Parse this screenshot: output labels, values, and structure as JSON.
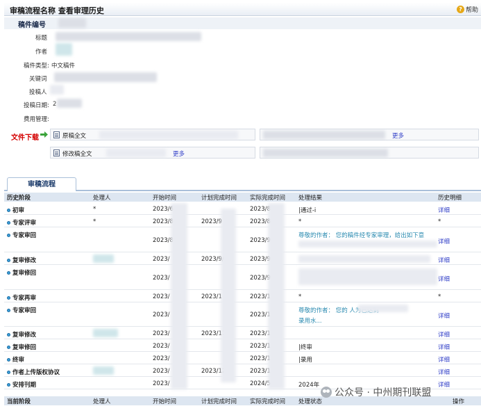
{
  "header": {
    "title": "审稿流程名称 查看审理历史",
    "help_label": "帮助"
  },
  "info": {
    "section_label": "稿件编号",
    "title_label": "标题",
    "author_label": "作者",
    "type_label": "稿件类型:",
    "type_value": "中文稿件",
    "keywords_label": "关键词",
    "submitter_label": "投稿人",
    "date_label": "投稿日期:",
    "date_value": "2",
    "fee_label": "费用管理:"
  },
  "downloads": {
    "label": "文件下载",
    "original_label": "原稿全文",
    "revised_label": "修改稿全文",
    "more_label": "更多"
  },
  "tab_label": "审稿流程",
  "history_columns": [
    "历史阶段",
    "处理人",
    "开始时间",
    "计划完成时间",
    "实际完成时间",
    "处理结果",
    "历史明细"
  ],
  "rows": [
    {
      "stage": "初审",
      "handler": "*",
      "start": "2023/6",
      "plan": "",
      "actual": "2023/8",
      "result": "|通过-i",
      "detail": "详细"
    },
    {
      "stage": "专家评审",
      "handler": "*",
      "start": "2023/8",
      "plan": "2023/9",
      "actual": "2023/8",
      "result": "*",
      "detail": "*"
    },
    {
      "stage": "专家审回",
      "handler": "",
      "start": "2023/8",
      "plan": "",
      "actual": "2023/9",
      "result": "尊敬的作者：  您的稿件经专家审理，给出如下意",
      "detail": "详细"
    },
    {
      "stage": "复审修改",
      "handler": "",
      "start": "2023/",
      "plan": "2023/9/",
      "actual": "2023/9",
      "result": "",
      "detail": "详细"
    },
    {
      "stage": "复审修回",
      "handler": "",
      "start": "2023/",
      "plan": "",
      "actual": "2023/9",
      "result": "",
      "detail": "详细"
    },
    {
      "stage": "专家再审",
      "handler": "",
      "start": "2023/",
      "plan": "2023/1",
      "actual": "2023/1",
      "result": "*",
      "detail": "*"
    },
    {
      "stage": "专家审回",
      "handler": "",
      "start": "2023/",
      "plan": "",
      "actual": "2023/1",
      "result": "尊敬的作者：  您的                  人为已达到",
      "result2": "录用水...",
      "detail": "详细"
    },
    {
      "stage": "复审修改",
      "handler": "",
      "start": "2023/",
      "plan": "2023/11,",
      "actual": "2023/1",
      "result": "",
      "detail": "详细"
    },
    {
      "stage": "复审修回",
      "handler": "",
      "start": "2023/",
      "plan": "",
      "actual": "2023/1",
      "result": "|终审",
      "detail": "详细"
    },
    {
      "stage": "终审",
      "handler": "",
      "start": "2023/",
      "plan": "",
      "actual": "2023/1",
      "result": "|录用",
      "detail": "详细"
    },
    {
      "stage": "作者上传版权协议",
      "handler": "",
      "start": "2023/",
      "plan": "2023/12/",
      "actual": "2023/1",
      "result": "",
      "detail": "详细"
    },
    {
      "stage": "安排刊期",
      "handler": "",
      "start": "2023/",
      "plan": "",
      "actual": "2024/5",
      "result": "2024年",
      "detail": "详细"
    }
  ],
  "current_columns": [
    "当前阶段",
    "处理人",
    "开始时间",
    "计划完成时间",
    "实际完成时间",
    "处理状态",
    "操作"
  ],
  "watermark": "公众号 · 中州期刊联盟"
}
